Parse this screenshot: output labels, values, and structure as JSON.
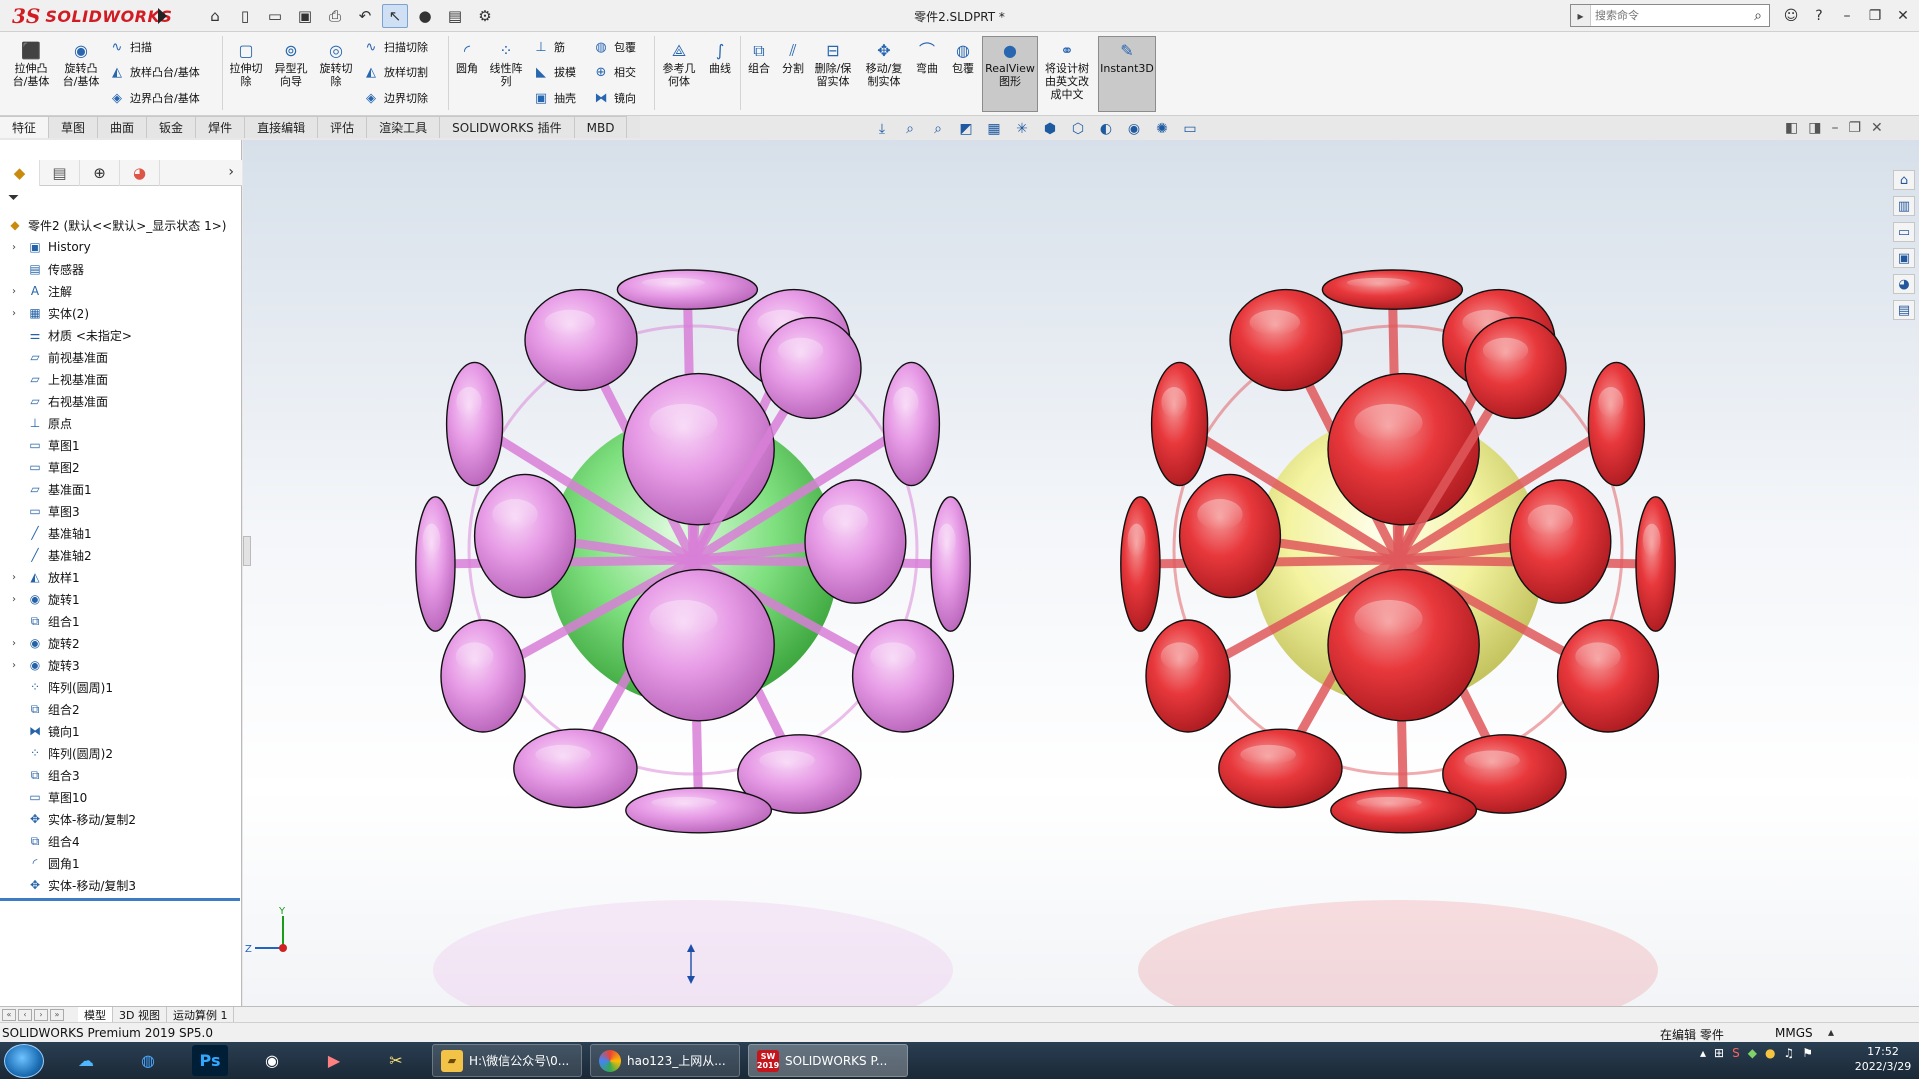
{
  "app": {
    "brand_ds": "3S",
    "brand_name": "SOLIDWORKS",
    "doc_title": "零件2.SLDPRT *"
  },
  "search": {
    "placeholder": "搜索命令"
  },
  "ribbon": {
    "extrude_boss": "拉伸凸台/基体",
    "revolve_boss": "旋转凸台/基体",
    "sweep": "扫描",
    "loft_boss": "放样凸台/基体",
    "boundary_boss": "边界凸台/基体",
    "extrude_cut": "拉伸切除",
    "hole_wizard": "异型孔向导",
    "revolve_cut": "旋转切除",
    "sweep_cut": "扫描切除",
    "loft_cut": "放样切割",
    "boundary_cut": "边界切除",
    "fillet": "圆角",
    "linear_pattern": "线性阵列",
    "rib": "筋",
    "draft": "拔模",
    "shell": "抽壳",
    "wrap": "包覆",
    "intersect": "相交",
    "mirror": "镜向",
    "ref_geometry": "参考几何体",
    "curves": "曲线",
    "combine": "组合",
    "split": "分割",
    "delete_keep_body": "删除/保留实体",
    "move_copy_body": "移动/复制实体",
    "flex": "弯曲",
    "wrap2": "包覆",
    "realview": "RealView图形",
    "translate_tree": "将设计树由英文改成中文",
    "instant3d": "Instant3D"
  },
  "tabs": [
    "特征",
    "草图",
    "曲面",
    "钣金",
    "焊件",
    "直接编辑",
    "评估",
    "渲染工具",
    "SOLIDWORKS 插件",
    "MBD"
  ],
  "tree": {
    "root": "零件2 (默认<<默认>_显示状态 1>)",
    "items": [
      "History",
      "传感器",
      "注解",
      "实体(2)",
      "材质 <未指定>",
      "前视基准面",
      "上视基准面",
      "右视基准面",
      "原点",
      "草图1",
      "草图2",
      "基准面1",
      "草图3",
      "基准轴1",
      "基准轴2",
      "放样1",
      "旋转1",
      "组合1",
      "旋转2",
      "旋转3",
      "阵列(圆周)1",
      "组合2",
      "镜向1",
      "阵列(圆周)2",
      "组合3",
      "草图10",
      "实体-移动/复制2",
      "组合4",
      "圆角1",
      "实体-移动/复制3"
    ]
  },
  "triad": {
    "y": "Y",
    "z": "Z"
  },
  "bottom_tabs": [
    "模型",
    "3D 视图",
    "运动算例 1"
  ],
  "status": {
    "app": "SOLIDWORKS Premium 2019 SP5.0",
    "mode": "在编辑 零件",
    "units": "MMGS"
  },
  "taskbar": {
    "task1": "H:\\微信公众号\\0...",
    "task2": "hao123_上网从...",
    "task3": "SOLIDWORKS P...",
    "task3_badge": "2019",
    "time": "17:52",
    "date": "2022/3/29"
  },
  "colors": {
    "accent": "#d11c23",
    "left_ball_petal": "#e79be6",
    "left_ball_core": "#7fe07f",
    "right_ball_petal": "#e8383c",
    "right_ball_core": "#f3f3a0"
  }
}
